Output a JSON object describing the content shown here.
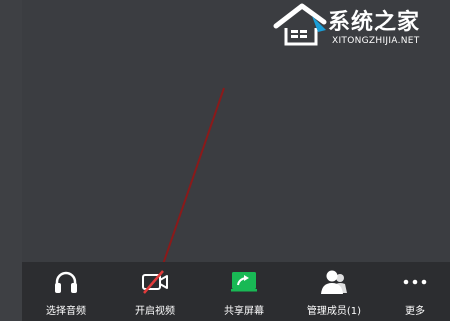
{
  "watermark": {
    "title": "系统之家",
    "url": "XITONGZHIJIA.NET"
  },
  "toolbar": {
    "items": [
      {
        "label": "选择音频",
        "icon": "headphones-icon"
      },
      {
        "label": "开启视频",
        "icon": "video-camera-off-icon"
      },
      {
        "label": "共享屏幕",
        "icon": "share-screen-icon"
      },
      {
        "label": "管理成员(1)",
        "icon": "members-icon"
      },
      {
        "label": "更多",
        "icon": "more-dots-icon"
      }
    ]
  },
  "colors": {
    "background": "#3b3d41",
    "toolbar": "#2c2d30",
    "accent_green": "#19b955",
    "annotation_line": "#8a1a1a"
  }
}
